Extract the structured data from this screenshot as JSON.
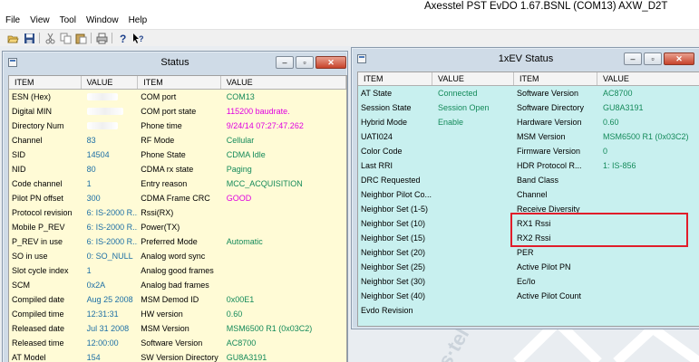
{
  "app": {
    "title": "Axesstel PST EvDO 1.67.BSNL (COM13) AXW_D2T"
  },
  "menu": [
    "File",
    "View",
    "Tool",
    "Window",
    "Help"
  ],
  "toolbar": {
    "icons": [
      "open-icon",
      "save-icon",
      "cut-icon",
      "copy-icon",
      "paste-icon",
      "print-icon",
      "about-icon",
      "context-help-icon"
    ]
  },
  "status_window": {
    "title": "Status",
    "headers": [
      "ITEM",
      "VALUE",
      "ITEM",
      "VALUE"
    ],
    "rows": [
      [
        "ESN (Hex)",
        "",
        "COM port",
        "COM13"
      ],
      [
        "Digital MIN",
        "",
        "COM port state",
        "115200 baudrate."
      ],
      [
        "Directory Num",
        "",
        "Phone time",
        "9/24/14 07:27:47.262"
      ],
      [
        "Channel",
        "83",
        "RF Mode",
        "Cellular"
      ],
      [
        "SID",
        "14504",
        "Phone State",
        "CDMA Idle"
      ],
      [
        "NID",
        "80",
        "CDMA rx state",
        "Paging"
      ],
      [
        "Code channel",
        "1",
        "Entry reason",
        "MCC_ACQUISITION"
      ],
      [
        "Pilot PN offset",
        "300",
        "CDMA Frame CRC",
        "GOOD"
      ],
      [
        "Protocol revision",
        "6:  IS-2000 R...",
        "Rssi(RX)",
        ""
      ],
      [
        "Mobile P_REV",
        "6:  IS-2000 R...",
        "Power(TX)",
        ""
      ],
      [
        "P_REV in use",
        "6:  IS-2000 R...",
        "Preferred Mode",
        "Automatic"
      ],
      [
        "SO in use",
        "0:  SO_NULL",
        "Analog word sync",
        ""
      ],
      [
        "Slot cycle index",
        "1",
        "Analog good frames",
        ""
      ],
      [
        "SCM",
        "0x2A",
        "Analog bad frames",
        ""
      ],
      [
        "Compiled date",
        "Aug 25 2008",
        "MSM Demod ID",
        "0x00E1"
      ],
      [
        "Compiled time",
        "12:31:31",
        "HW version",
        "0.60"
      ],
      [
        "Released date",
        "Jul 31 2008",
        "MSM Version",
        "MSM6500 R1 (0x03C2)"
      ],
      [
        "Released time",
        "12:00:00",
        "Software Version",
        "AC8700"
      ],
      [
        "AT Model",
        "154",
        "SW Version Directory",
        "GU8A3191"
      ]
    ]
  },
  "ev_window": {
    "title": "1xEV Status",
    "headers": [
      "ITEM",
      "VALUE",
      "ITEM",
      "VALUE"
    ],
    "rows": [
      [
        "AT State",
        "Connected",
        "Software Version",
        "AC8700"
      ],
      [
        "Session State",
        "Session Open",
        "Software Directory",
        "GU8A3191"
      ],
      [
        "Hybrid Mode",
        "Enable",
        "Hardware Version",
        "0.60"
      ],
      [
        "UATI024",
        "",
        "MSM Version",
        "MSM6500 R1 (0x03C2)"
      ],
      [
        "Color Code",
        "",
        "Firmware Version",
        "0"
      ],
      [
        "Last RRI",
        "",
        "HDR Protocol R...",
        "1: IS-856"
      ],
      [
        "DRC Requested",
        "",
        "Band Class",
        ""
      ],
      [
        "Neighbor Pilot Co...",
        "",
        "Channel",
        ""
      ],
      [
        "Neighbor Set (1-5)",
        "",
        "Receive Diversity",
        ""
      ],
      [
        "Neighbor Set (10)",
        "",
        "RX1 Rssi",
        ""
      ],
      [
        "Neighbor Set (15)",
        "",
        "RX2 Rssi",
        ""
      ],
      [
        "Neighbor Set (20)",
        "",
        "PER",
        ""
      ],
      [
        "Neighbor Set (25)",
        "",
        "Active Pilot PN",
        ""
      ],
      [
        "Neighbor Set (30)",
        "",
        "Ec/Io",
        ""
      ],
      [
        "Neighbor Set (40)",
        "",
        "Active Pilot Count",
        ""
      ],
      [
        "Evdo Revision",
        "",
        "",
        ""
      ]
    ]
  },
  "watermark": "s·tel",
  "colors": {
    "status_bg": "#fffbd6",
    "ev_bg": "#c8f0ef",
    "value_blue": "#1d6fa5",
    "value_pink": "#e000e0",
    "value_green": "#148a5a",
    "highlight": "#e11d2a"
  }
}
